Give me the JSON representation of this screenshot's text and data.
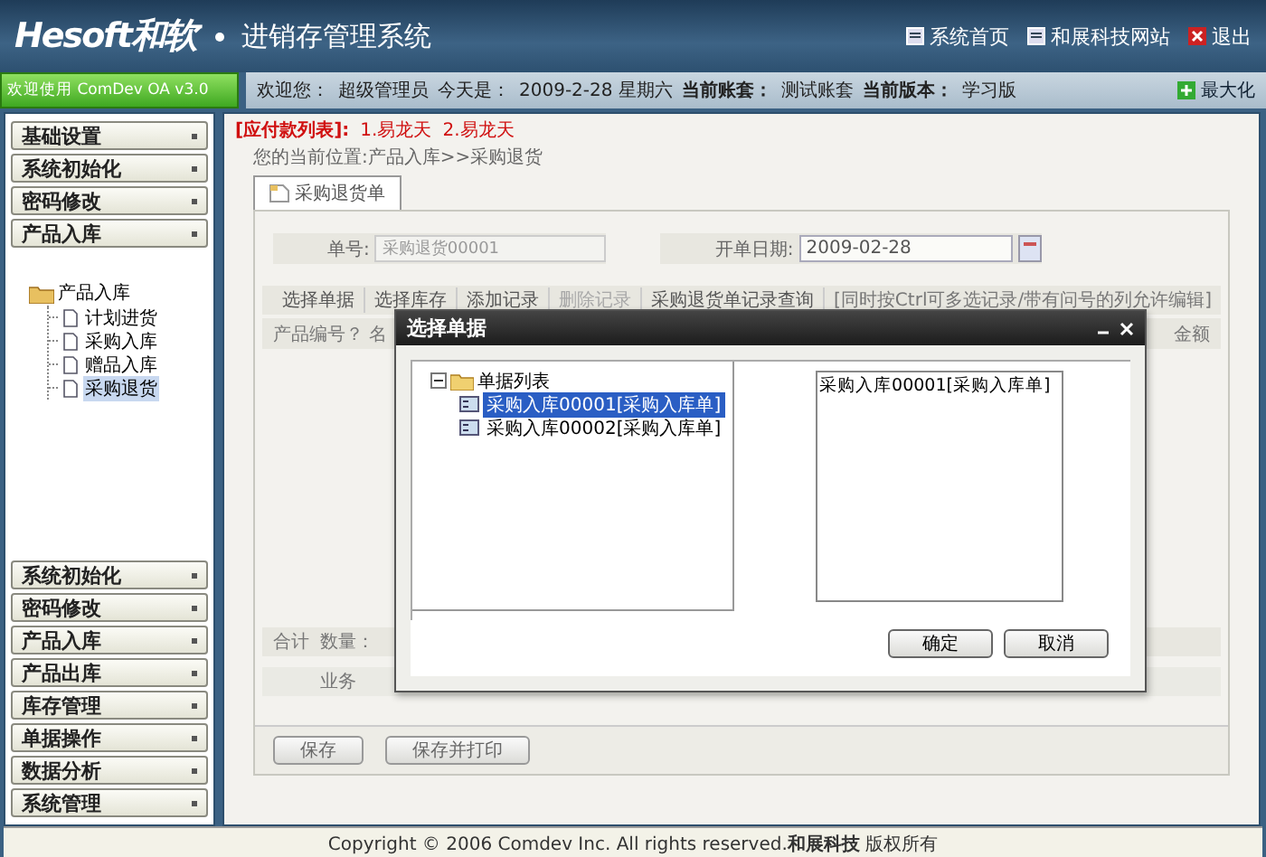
{
  "header": {
    "logo": "Hesoft和软",
    "title": "进销存管理系统",
    "links": [
      {
        "label": "系统首页",
        "kind": "page"
      },
      {
        "label": "和展科技网站",
        "kind": "page"
      },
      {
        "label": "退出",
        "kind": "exit"
      }
    ]
  },
  "infobar": {
    "welcome": "欢迎使用 ComDev OA v3.0",
    "user_label": "欢迎您：",
    "user": "超级管理员",
    "today_label": "今天是：",
    "today": "2009-2-28 星期六",
    "account_label": "当前账套：",
    "account": "测试账套",
    "version_label": "当前版本：",
    "version": "学习版",
    "maximize": "最大化"
  },
  "sidebar": {
    "top_sections": [
      "基础设置",
      "系统初始化",
      "密码修改",
      "产品入库"
    ],
    "tree": {
      "label": "产品入库",
      "children": [
        {
          "label": "计划进货",
          "selected": false
        },
        {
          "label": "采购入库",
          "selected": false
        },
        {
          "label": "赠品入库",
          "selected": false
        },
        {
          "label": "采购退货",
          "selected": true
        }
      ]
    },
    "bottom_sections": [
      "系统初始化",
      "密码修改",
      "产品入库",
      "产品出库",
      "库存管理",
      "单据操作",
      "数据分析",
      "系统管理"
    ]
  },
  "main": {
    "notice": {
      "label": "[应付款列表]:",
      "items": [
        "1.易龙天",
        "2.易龙天"
      ]
    },
    "breadcrumb": "您的当前位置:产品入库>>采购退货",
    "tab": {
      "label": "采购退货单",
      "selected": true
    },
    "form": {
      "number_label": "单号:",
      "number_value": "采购退货00001",
      "date_label": "开单日期:",
      "date_value": "2009-02-28"
    },
    "toolbar": [
      {
        "label": "选择单据",
        "disabled": false
      },
      {
        "label": "选择库存",
        "disabled": false
      },
      {
        "label": "添加记录",
        "disabled": false
      },
      {
        "label": "删除记录",
        "disabled": true
      },
      {
        "label": "采购退货单记录查询",
        "disabled": false
      }
    ],
    "hint": "[同时按Ctrl可多选记录/带有问号的列允许编辑]",
    "columns": [
      "产品编号？",
      "名",
      "金额"
    ],
    "totals": [
      "合计",
      "数量："
    ],
    "business_label": "业务",
    "buttons": [
      "保存",
      "保存并打印"
    ]
  },
  "dialog": {
    "title": "选择单据",
    "tree": {
      "label": "单据列表",
      "expanded": true,
      "children": [
        {
          "label": "采购入库00001[采购入库单]",
          "selected": true
        },
        {
          "label": "采购入库00002[采购入库单]",
          "selected": false
        }
      ]
    },
    "selected_list": [
      "采购入库00001[采购入库单]"
    ],
    "buttons": [
      "确定",
      "取消"
    ]
  },
  "footer": {
    "copyright": "Copyright © 2006 Comdev Inc. All rights reserved.",
    "company": "和展科技",
    "rights": "版权所有"
  }
}
